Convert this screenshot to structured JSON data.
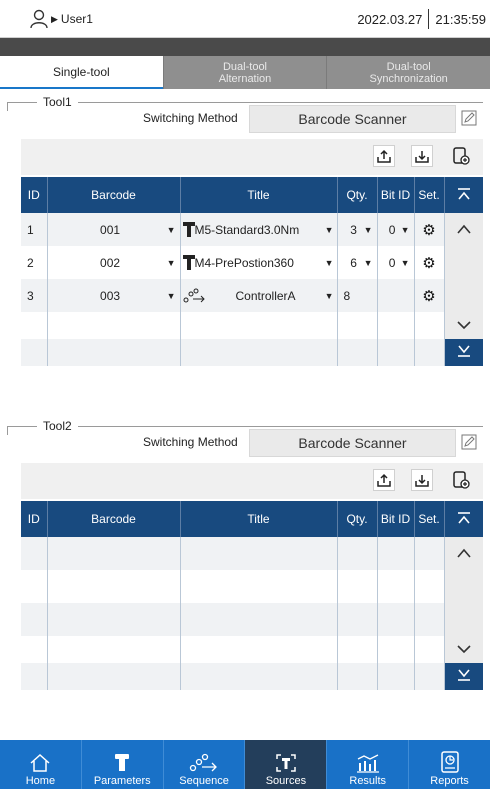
{
  "header": {
    "user": "User1",
    "date": "2022.03.27",
    "time": "21:35:59"
  },
  "tabs": [
    {
      "label": "Single-tool",
      "active": true
    },
    {
      "label": "Dual-tool\nAlternation",
      "active": false
    },
    {
      "label": "Dual-tool\nSynchronization",
      "active": false
    }
  ],
  "tool1": {
    "title": "Tool1",
    "switch_label": "Switching Method",
    "switch_value": "Barcode Scanner",
    "columns": [
      "ID",
      "Barcode",
      "Title",
      "Qty.",
      "Bit ID",
      "Set."
    ],
    "rows": [
      {
        "id": "1",
        "barcode": "001",
        "title": "M5-Standard3.0Nm",
        "qty": "3",
        "bit": "0"
      },
      {
        "id": "2",
        "barcode": "002",
        "title": "M4-PrePostion360",
        "qty": "6",
        "bit": "0"
      },
      {
        "id": "3",
        "barcode": "003",
        "title": "ControllerA",
        "qty": "8",
        "bit": ""
      }
    ]
  },
  "tool2": {
    "title": "Tool2",
    "switch_label": "Switching Method",
    "switch_value": "Barcode Scanner",
    "columns": [
      "ID",
      "Barcode",
      "Title",
      "Qty.",
      "Bit ID",
      "Set."
    ]
  },
  "nav": [
    {
      "label": "Home",
      "icon": "home-icon",
      "active": false
    },
    {
      "label": "Parameters",
      "icon": "screw-icon",
      "active": false
    },
    {
      "label": "Sequence",
      "icon": "sequence-icon",
      "active": false
    },
    {
      "label": "Sources",
      "icon": "sources-icon",
      "active": true
    },
    {
      "label": "Results",
      "icon": "results-icon",
      "active": false
    },
    {
      "label": "Reports",
      "icon": "reports-icon",
      "active": false
    }
  ],
  "colors": {
    "header_blue": "#184a7f",
    "nav_blue": "#1971c7",
    "nav_active": "#233e5b"
  }
}
